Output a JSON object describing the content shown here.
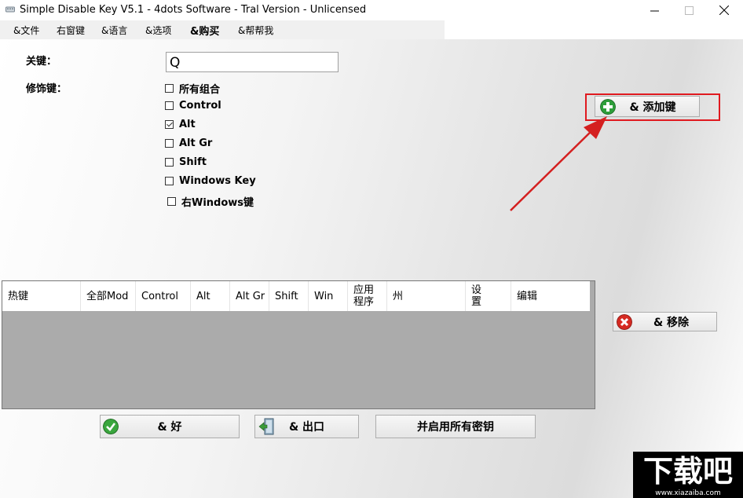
{
  "window": {
    "title": "Simple Disable Key V5.1 - 4dots Software - Tral Version - Unlicensed",
    "controls": {
      "minimize": "—",
      "maximize": "☐",
      "close": "✕"
    }
  },
  "menu": {
    "items": [
      "&文件",
      "右窗键",
      "&语言",
      "&选项",
      "&购买",
      "&帮帮我"
    ]
  },
  "form": {
    "key_label": "关键：",
    "key_value": "Q",
    "modifier_label": "修饰键："
  },
  "modifiers": [
    {
      "label": "所有组合",
      "checked": false
    },
    {
      "label": "Control",
      "checked": false
    },
    {
      "label": "Alt",
      "checked": true
    },
    {
      "label": "Alt Gr",
      "checked": false
    },
    {
      "label": "Shift",
      "checked": false
    },
    {
      "label": "Windows Key",
      "checked": false
    },
    {
      "label": "右Windows键",
      "checked": false
    }
  ],
  "buttons": {
    "add": "& 添加键",
    "remove": "& 移除",
    "ok": "& 好",
    "exit": "& 出口",
    "enable_all": "并启用所有密钥"
  },
  "table": {
    "columns": [
      "热键",
      "全部Mod",
      "Control",
      "Alt",
      "Alt Gr",
      "Shift",
      "Win",
      "应用\n程序",
      "州",
      "设\n置",
      "编辑"
    ]
  },
  "watermark": {
    "text": "下载吧",
    "url": "www.xiazaiba.com"
  },
  "colors": {
    "highlight": "#e0191f",
    "arrow": "#d42020",
    "grid_bg": "#ababab"
  }
}
